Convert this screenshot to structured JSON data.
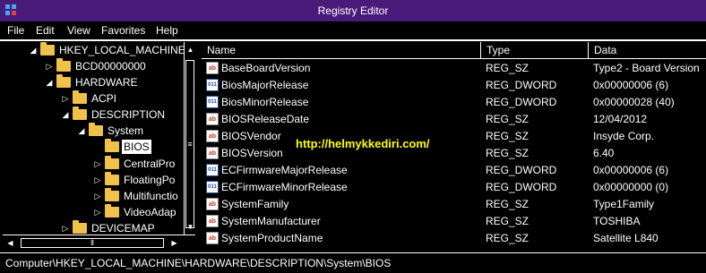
{
  "window": {
    "title": "Registry Editor"
  },
  "menu": [
    "File",
    "Edit",
    "View",
    "Favorites",
    "Help"
  ],
  "tree": [
    {
      "label": "HKEY_LOCAL_MACHINE",
      "expander": "◢"
    },
    {
      "label": "BCD00000000",
      "expander": "▷"
    },
    {
      "label": "HARDWARE",
      "expander": "◢"
    },
    {
      "label": "ACPI",
      "expander": "▷"
    },
    {
      "label": "DESCRIPTION",
      "expander": "◢"
    },
    {
      "label": "System",
      "expander": "◢"
    },
    {
      "label": "BIOS",
      "expander": ""
    },
    {
      "label": "CentralPro",
      "expander": "▷"
    },
    {
      "label": "FloatingPo",
      "expander": "▷"
    },
    {
      "label": "Multifunctio",
      "expander": "▷"
    },
    {
      "label": "VideoAdap",
      "expander": "▷"
    },
    {
      "label": "DEVICEMAP",
      "expander": "▷"
    }
  ],
  "columns": {
    "name": "Name",
    "type": "Type",
    "data": "Data"
  },
  "values": [
    {
      "icon": "string-value-icon",
      "name": "BaseBoardVersion",
      "type": "REG_SZ",
      "data": "Type2 - Board Version"
    },
    {
      "icon": "dword-value-icon",
      "name": "BiosMajorRelease",
      "type": "REG_DWORD",
      "data": "0x00000006 (6)"
    },
    {
      "icon": "dword-value-icon",
      "name": "BiosMinorRelease",
      "type": "REG_DWORD",
      "data": "0x00000028 (40)"
    },
    {
      "icon": "string-value-icon",
      "name": "BIOSReleaseDate",
      "type": "REG_SZ",
      "data": "12/04/2012"
    },
    {
      "icon": "string-value-icon",
      "name": "BIOSVendor",
      "type": "REG_SZ",
      "data": "Insyde Corp."
    },
    {
      "icon": "string-value-icon",
      "name": "BIOSVersion",
      "type": "REG_SZ",
      "data": "6.40"
    },
    {
      "icon": "dword-value-icon",
      "name": "ECFirmwareMajorRelease",
      "type": "REG_DWORD",
      "data": "0x00000006 (6)"
    },
    {
      "icon": "dword-value-icon",
      "name": "ECFirmwareMinorRelease",
      "type": "REG_DWORD",
      "data": "0x00000000 (0)"
    },
    {
      "icon": "string-value-icon",
      "name": "SystemFamily",
      "type": "REG_SZ",
      "data": "Type1Family"
    },
    {
      "icon": "string-value-icon",
      "name": "SystemManufacturer",
      "type": "REG_SZ",
      "data": "TOSHIBA"
    },
    {
      "icon": "string-value-icon",
      "name": "SystemProductName",
      "type": "REG_SZ",
      "data": "Satellite L840"
    }
  ],
  "watermark": "http://helmykkediri.com/",
  "status": {
    "path": "Computer\\HKEY_LOCAL_MACHINE\\HARDWARE\\DESCRIPTION\\System\\BIOS"
  },
  "colors": {
    "titlebar": "#4a1a7a",
    "background": "#000000",
    "selection": "#ffffff",
    "folder": "#f0c14b",
    "watermark": "#ffff00"
  }
}
